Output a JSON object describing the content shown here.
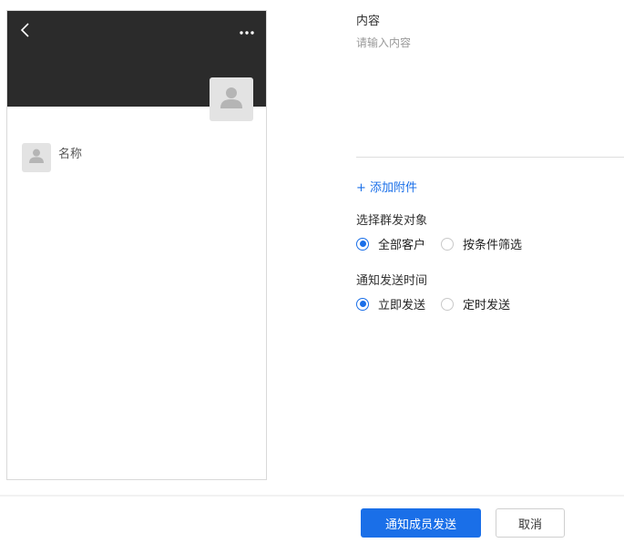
{
  "preview": {
    "name": "名称",
    "icons": {
      "back": "chevron-left-icon",
      "more": "more-horizontal-icon",
      "avatar": "user-avatar-icon"
    },
    "header_color": "#2b2b2b"
  },
  "form": {
    "content_label": "内容",
    "content_placeholder": "请输入内容",
    "content_value": "",
    "add_attachment": "+ 添加附件",
    "target_label": "选择群发对象",
    "target_options": [
      "全部客户",
      "按条件筛选"
    ],
    "target_selected": "全部客户",
    "time_label": "通知发送时间",
    "time_options": [
      "立即发送",
      "定时发送"
    ],
    "time_selected": "立即发送"
  },
  "footer": {
    "submit_label": "通知成员发送",
    "cancel_label": "取消"
  },
  "colors": {
    "accent": "#1a6fe8",
    "avatar_bg": "#e3e3e3"
  }
}
